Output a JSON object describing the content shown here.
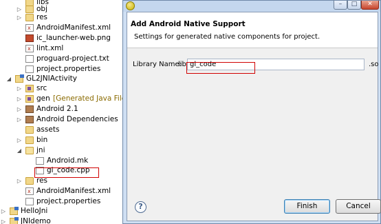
{
  "tree": {
    "items": [
      {
        "label": "libs",
        "icon": "folder-icon",
        "twisty": ""
      },
      {
        "label": "obj",
        "icon": "folder-icon",
        "twisty": "▷"
      },
      {
        "label": "res",
        "icon": "folder-icon",
        "twisty": "▷"
      },
      {
        "label": "AndroidManifest.xml",
        "icon": "xml-file-icon",
        "twisty": ""
      },
      {
        "label": "ic_launcher-web.png",
        "icon": "image-file-icon",
        "twisty": ""
      },
      {
        "label": "lint.xml",
        "icon": "xml-file-icon",
        "twisty": ""
      },
      {
        "label": "proguard-project.txt",
        "icon": "text-file-icon",
        "twisty": ""
      },
      {
        "label": "project.properties",
        "icon": "text-file-icon",
        "twisty": ""
      },
      {
        "label": "GL2JNIActivity",
        "icon": "android-project-icon",
        "twisty": "◢"
      },
      {
        "label": "src",
        "icon": "source-folder-icon",
        "twisty": "▷"
      },
      {
        "label": "gen",
        "suffix": "[Generated Java Files]",
        "icon": "source-folder-icon",
        "twisty": "▷"
      },
      {
        "label": "Android 2.1",
        "icon": "library-icon",
        "twisty": "▷"
      },
      {
        "label": "Android Dependencies",
        "icon": "library-icon",
        "twisty": "▷"
      },
      {
        "label": "assets",
        "icon": "folder-icon",
        "twisty": ""
      },
      {
        "label": "bin",
        "icon": "folder-icon",
        "twisty": "▷"
      },
      {
        "label": "jni",
        "icon": "folder-open-icon",
        "twisty": "◢"
      },
      {
        "label": "Android.mk",
        "icon": "text-file-icon",
        "twisty": ""
      },
      {
        "label": "gl_code.cpp",
        "icon": "cpp-file-icon",
        "twisty": ""
      },
      {
        "label": "res",
        "icon": "folder-icon",
        "twisty": "▷"
      },
      {
        "label": "AndroidManifest.xml",
        "icon": "xml-file-icon",
        "twisty": ""
      },
      {
        "label": "project.properties",
        "icon": "text-file-icon",
        "twisty": ""
      },
      {
        "label": "HelloJni",
        "icon": "android-project-icon",
        "twisty": "▷"
      },
      {
        "label": "JNIdemo",
        "icon": "android-project-icon",
        "twisty": "▷"
      }
    ]
  },
  "dialog": {
    "title_buttons": {
      "minimize": "–",
      "maximize": "□",
      "close": "✕"
    },
    "title": "Add Android Native Support",
    "subtitle": "Settings for generated native components for project.",
    "library_name_label": "Library Name:",
    "library_prefix": "lib",
    "library_name_value": "gl_code",
    "library_suffix": ".so",
    "help_label": "?",
    "finish_label": "Finish",
    "cancel_label": "Cancel"
  },
  "colors": {
    "highlight_box": "#d00000",
    "dialog_frame": "#cfdff3",
    "content_bg": "#f0f0f0"
  }
}
